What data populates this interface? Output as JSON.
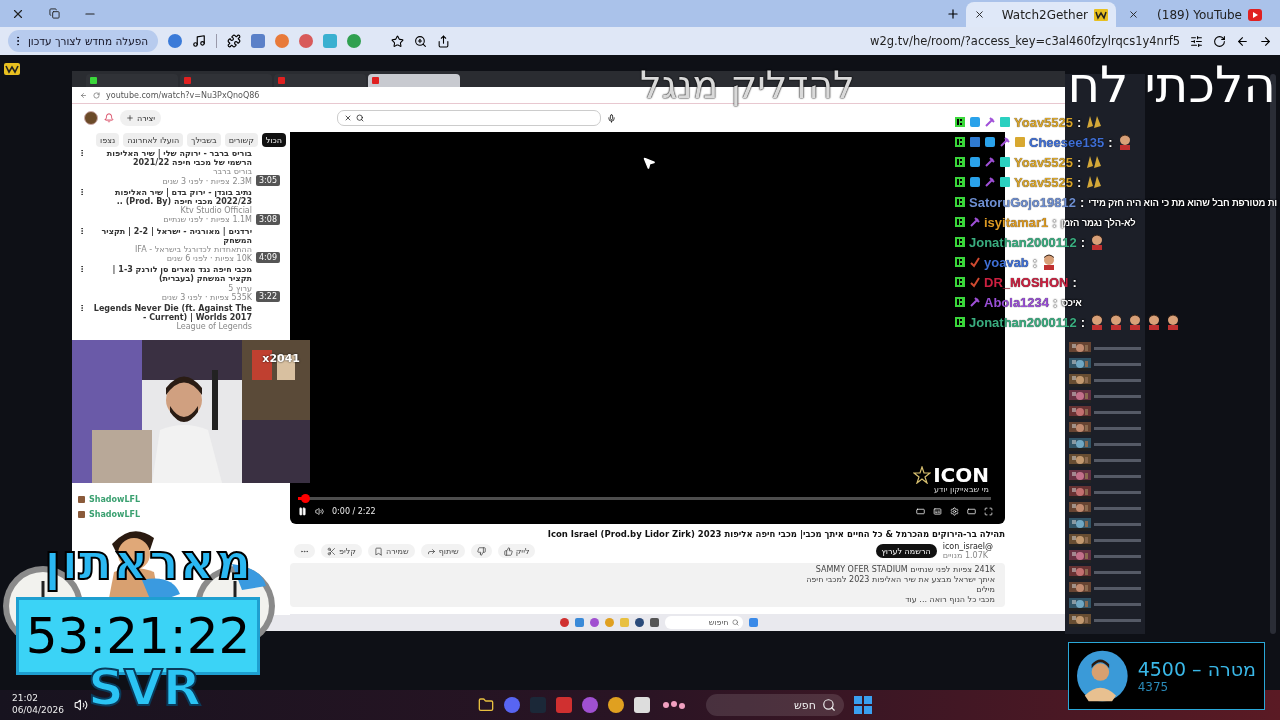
{
  "browser": {
    "tabs": [
      {
        "title": "(189) YouTube",
        "kind": "youtube",
        "selected": false
      },
      {
        "title": "Watch2Gether",
        "kind": "w2g",
        "selected": true
      }
    ],
    "update_button": "הפעלה מחדש לצורך עדכון",
    "url": "w2g.tv/he/room/?access_key=c3al460fzylrqcs1y4nrf5"
  },
  "overlay_title": {
    "main": "הלכתי לח",
    "faded": "להדליק מנגל"
  },
  "captured_browser": {
    "tabs": [
      {
        "kind": "kick",
        "selected": false
      },
      {
        "kind": "youtube",
        "selected": false
      },
      {
        "kind": "youtube",
        "selected": false
      },
      {
        "kind": "youtube",
        "selected": true
      }
    ],
    "url": "youtube.com/watch?v=Nu3PxQnoQ86"
  },
  "youtube": {
    "create_label": "יצירה",
    "chips": [
      {
        "label": "הכול",
        "selected": true
      },
      {
        "label": "קשורים",
        "selected": false
      },
      {
        "label": "בשבילך",
        "selected": false
      },
      {
        "label": "הועלו לאחרונה",
        "selected": false
      },
      {
        "label": "נצפו",
        "selected": false
      }
    ],
    "related": [
      {
        "title": "בוריס ברבר - ירוקה שלי | שיר האליפות הרשמי של מכבי חיפה 2021/22",
        "channel": "בוריס ברבר",
        "meta": "2.3M צפיות · לפני 3 שנים",
        "duration": "3:05"
      },
      {
        "title": "נתיב בוגדן - ירוק בדם | שיר האליפות 2022/23 מכבי חיפה (Prod. By) ..",
        "channel": "Ktv Studio Official",
        "meta": "1.1M צפיות · לפני שנתיים",
        "duration": "3:08"
      },
      {
        "title": "ירדנים | מאורגיה - ישראל | 2-2 | תקציר המשחק",
        "channel": "ההתאחדות לכדורגל בישראל - IFA",
        "meta": "10K צפיות · לפני 6 שנים",
        "duration": "4:09"
      },
      {
        "title": "מכבי חיפה נגד מארים סן לורנק 1-3 | תקציר המשחק (בעברית)",
        "channel": "ערוץ 5",
        "meta": "535K צפיות · לפני 3 שנים",
        "duration": "3:22"
      },
      {
        "title": "Legends Never Die (ft. Against The Current) | Worlds 2017 -",
        "channel": "League of Legends"
      }
    ]
  },
  "player": {
    "playing": true,
    "level": 0.01,
    "time": "0:00 / 2:22",
    "logo": "ICON",
    "logo_tagline": "מי שבאייקון יודע"
  },
  "video": {
    "title": "תהילה בר-הירוקים מהכרמל & כל החיים איתך מכבי| מכבי חיפה אליפות 2023 Icon Israel (Prod.by Lidor Zirk)",
    "channel": "@icon_israel",
    "subscribers": "1.07K מנויים",
    "subscribe": "הרשמה לערוץ",
    "actions": [
      {
        "label": "לייק",
        "kind": "like"
      },
      {
        "kind": "dislike"
      },
      {
        "label": "שיתוף",
        "kind": "share"
      },
      {
        "label": "שמירה",
        "kind": "save"
      },
      {
        "label": "קליפ",
        "kind": "clip"
      },
      {
        "kind": "more"
      }
    ],
    "description": [
      "241K צפיות  לפני שנתיים  SAMMY OFER STADIUM",
      "איתך ישראל מבצע את שיר האליפות 2023 למכבי חיפה",
      "מילים",
      "מכבי כל הנוף רואה ... עוד"
    ]
  },
  "captured_taskbar": {
    "search": "חיפוש"
  },
  "webcam": {
    "badge": "x2041"
  },
  "side_chat": [
    {
      "user": "ShadowLFL"
    },
    {
      "user": "ShadowLFL"
    }
  ],
  "chat": [
    {
      "user": "Yoav5525",
      "color": "#d9a52a",
      "separator": ":",
      "badges": [
        {
          "kind": "k"
        },
        {
          "kind": "cube"
        },
        {
          "kind": "pick"
        },
        {
          "kind": "gift"
        }
      ],
      "emotes": [
        {
          "kind": "hands"
        }
      ]
    },
    {
      "user": "Cheesee135",
      "color": "#3f6fd6",
      "separator": ":",
      "badges": [
        {
          "kind": "k"
        },
        {
          "kind": "sword"
        },
        {
          "kind": "cube"
        },
        {
          "kind": "pick"
        },
        {
          "kind": "crown"
        }
      ],
      "emotes": [
        {
          "kind": "face"
        }
      ]
    },
    {
      "user": "Yoav5525",
      "color": "#d9a52a",
      "separator": ":",
      "badges": [
        {
          "kind": "k"
        },
        {
          "kind": "cube"
        },
        {
          "kind": "pick"
        },
        {
          "kind": "gift"
        }
      ],
      "emotes": [
        {
          "kind": "hands"
        }
      ]
    },
    {
      "user": "Yoav5525",
      "color": "#d9a52a",
      "separator": ":",
      "badges": [
        {
          "kind": "k"
        },
        {
          "kind": "cube"
        },
        {
          "kind": "pick"
        },
        {
          "kind": "gift"
        }
      ],
      "emotes": [
        {
          "kind": "hands"
        }
      ]
    },
    {
      "user": "SatoruGojo19812",
      "color": "#6e8fd2",
      "separator": ":",
      "badges": [
        {
          "kind": "k"
        }
      ],
      "message": "ות מטורפת חבל שהוא מת כי הוא היה חזק מידי"
    },
    {
      "user": "isyitamar1",
      "color": "#dc9a22",
      "separator": ":",
      "badges": [
        {
          "kind": "k"
        },
        {
          "kind": "pick"
        }
      ],
      "message": "לא-הלך נגמר הזמן"
    },
    {
      "user": "Jonathan2000112",
      "color": "#3aae80",
      "separator": ":",
      "badges": [
        {
          "kind": "k"
        }
      ],
      "emotes": [
        {
          "kind": "face"
        }
      ]
    },
    {
      "user": "yoavab",
      "color": "#3f6fd6",
      "separator": ":",
      "badges": [
        {
          "kind": "k"
        },
        {
          "kind": "check"
        }
      ],
      "emotes": [
        {
          "kind": "face"
        }
      ]
    },
    {
      "user": "DR_MOSHON",
      "color": "#cc2040",
      "separator": ":",
      "badges": [
        {
          "kind": "k"
        },
        {
          "kind": "check"
        }
      ]
    },
    {
      "user": "Abola1234",
      "color": "#9a4fd6",
      "separator": ":",
      "badges": [
        {
          "kind": "k"
        },
        {
          "kind": "pick"
        }
      ],
      "message": "איכס"
    },
    {
      "user": "Jonathan2000112",
      "color": "#3aae80",
      "separator": ":",
      "badges": [
        {
          "kind": "k"
        }
      ],
      "emotes": [
        {
          "kind": "face"
        },
        {
          "kind": "face"
        },
        {
          "kind": "face"
        },
        {
          "kind": "face"
        },
        {
          "kind": "face"
        }
      ]
    }
  ],
  "timer": {
    "title": "מאראתון",
    "time": "53:21:22",
    "label": "SVR"
  },
  "taskbar": {
    "time": "21:02",
    "date": "06/04/2026",
    "search": "חפש"
  },
  "goal": {
    "label": "מטרה – 4500",
    "current": "4375"
  }
}
